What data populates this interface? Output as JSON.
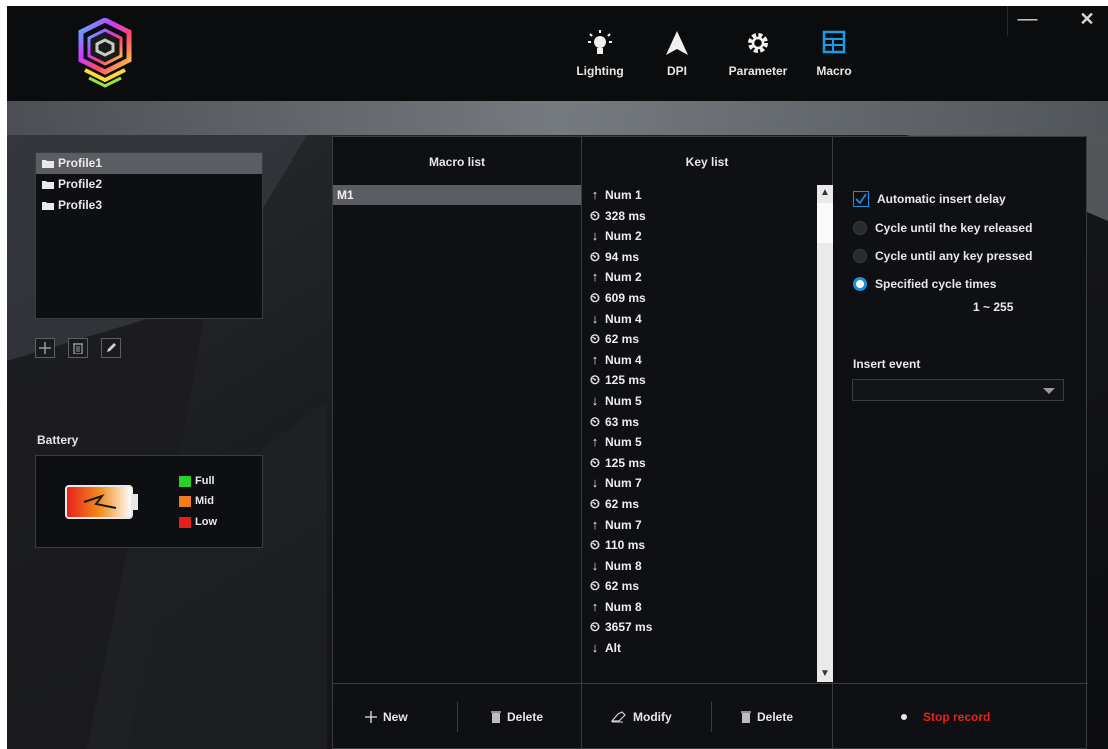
{
  "nav": [
    {
      "label": "Lighting",
      "icon": "lightbulb-icon",
      "active": false
    },
    {
      "label": "DPI",
      "icon": "arrow-up-icon",
      "active": false
    },
    {
      "label": "Parameter",
      "icon": "gear-icon",
      "active": false
    },
    {
      "label": "Macro",
      "icon": "table-icon",
      "active": true
    }
  ],
  "window": {
    "minimize": "—",
    "close": "✕"
  },
  "profiles": [
    "Profile1",
    "Profile2",
    "Profile3"
  ],
  "profile_tools": {
    "add": "+",
    "delete": "trash-icon",
    "edit": "pencil-icon"
  },
  "battery": {
    "title": "Battery",
    "legend": [
      {
        "label": "Full",
        "color": "#2ad02a"
      },
      {
        "label": "Mid",
        "color": "#f07d1c"
      },
      {
        "label": "Low",
        "color": "#e81d1d"
      }
    ]
  },
  "macro": {
    "macro_list_header": "Macro list",
    "key_list_header": "Key list",
    "macros": [
      "M1"
    ],
    "keys": [
      {
        "type": "up",
        "text": "Num 1"
      },
      {
        "type": "delay",
        "text": "328 ms"
      },
      {
        "type": "down",
        "text": "Num 2"
      },
      {
        "type": "delay",
        "text": "94 ms"
      },
      {
        "type": "up",
        "text": "Num 2"
      },
      {
        "type": "delay",
        "text": "609 ms"
      },
      {
        "type": "down",
        "text": "Num 4"
      },
      {
        "type": "delay",
        "text": "62 ms"
      },
      {
        "type": "up",
        "text": "Num 4"
      },
      {
        "type": "delay",
        "text": "125 ms"
      },
      {
        "type": "down",
        "text": "Num 5"
      },
      {
        "type": "delay",
        "text": "63 ms"
      },
      {
        "type": "up",
        "text": "Num 5"
      },
      {
        "type": "delay",
        "text": "125 ms"
      },
      {
        "type": "down",
        "text": "Num 7"
      },
      {
        "type": "delay",
        "text": "62 ms"
      },
      {
        "type": "up",
        "text": "Num 7"
      },
      {
        "type": "delay",
        "text": "110 ms"
      },
      {
        "type": "down",
        "text": "Num 8"
      },
      {
        "type": "delay",
        "text": "62 ms"
      },
      {
        "type": "up",
        "text": "Num 8"
      },
      {
        "type": "delay",
        "text": "3657 ms"
      },
      {
        "type": "down",
        "text": "Alt"
      }
    ],
    "options": {
      "auto_delay": "Automatic insert delay",
      "cycle_released": "Cycle until the key released",
      "cycle_any_key": "Cycle until any key pressed",
      "specified_times": "Specified cycle times",
      "range": "1 ~ 255"
    },
    "insert_event_label": "Insert event",
    "insert_event_value": "",
    "footer": {
      "new": "New",
      "delete_macro": "Delete",
      "modify": "Modify",
      "delete_key": "Delete",
      "stop_record": "Stop record"
    }
  },
  "colors": {
    "accent": "#1e8fe0",
    "record": "#e4241b"
  }
}
